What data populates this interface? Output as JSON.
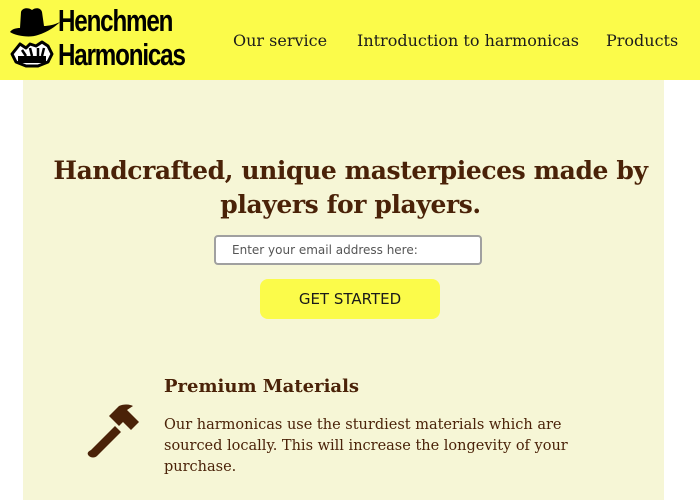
{
  "header": {
    "brand": {
      "line1": "Henchmen",
      "line2": "Harmonicas",
      "icon": "cowboy-hat-hands-harmonica-icon"
    },
    "nav": [
      {
        "label": "Our service"
      },
      {
        "label": "Introduction to harmonicas"
      },
      {
        "label": "Products"
      }
    ],
    "background_color": "#fbfb4a"
  },
  "hero": {
    "title": "Handcrafted, unique masterpieces made by players for players.",
    "email_placeholder": "Enter your email address here:",
    "cta_label": "GET STARTED",
    "background_color": "#f6f6d6",
    "accent_color": "#4a2208"
  },
  "features": [
    {
      "icon": "hammer-icon",
      "title": "Premium Materials",
      "text": "Our harmonicas use the sturdiest materials which are sourced locally. This will increase the longevity of your purchase."
    }
  ]
}
